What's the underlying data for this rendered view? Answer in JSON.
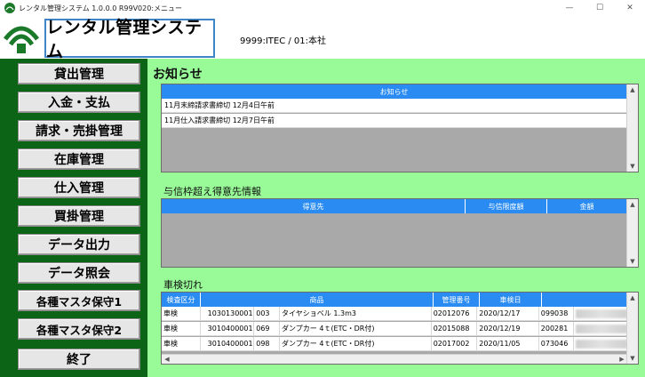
{
  "window": {
    "title": "レンタル管理システム 1.0.0.0 R99V020:メニュー",
    "minimize": "—",
    "maximize": "☐",
    "close": "✕"
  },
  "header": {
    "app_title": "レンタル管理システム",
    "company": "9999:ITEC / 01:本社"
  },
  "sidebar": {
    "items": [
      {
        "label": "貸出管理"
      },
      {
        "label": "入金・支払"
      },
      {
        "label": "請求・売掛管理"
      },
      {
        "label": "在庫管理"
      },
      {
        "label": "仕入管理"
      },
      {
        "label": "買掛管理"
      },
      {
        "label": "データ出力"
      },
      {
        "label": "データ照会"
      },
      {
        "label": "各種マスタ保守1"
      },
      {
        "label": "各種マスタ保守2"
      },
      {
        "label": "終了"
      }
    ]
  },
  "notices": {
    "title": "お知らせ",
    "column": "お知らせ",
    "rows": [
      "11月末締請求書締切  12月4日午前",
      "11月仕入請求書締切  12月7日午前"
    ]
  },
  "credit": {
    "title": "与信枠超え得意先情報",
    "columns": [
      "得意先",
      "与信限度額",
      "金額"
    ]
  },
  "inspection": {
    "title": "車検切れ",
    "columns": [
      "検査区分",
      "商品",
      "管理番号",
      "車検日"
    ],
    "rows": [
      {
        "kubun": "車検",
        "code": "1030130001",
        "sub": "003",
        "name": "タイヤショベル 1.3m3",
        "kanri": "02012076",
        "date": "2020/12/17",
        "no": "099038"
      },
      {
        "kubun": "車検",
        "code": "3010400001",
        "sub": "069",
        "name": "ダンプカー 4ｔ(ETC・DR付)",
        "kanri": "02015088",
        "date": "2020/12/19",
        "no": "200281"
      },
      {
        "kubun": "車検",
        "code": "3010400001",
        "sub": "098",
        "name": "ダンプカー 4ｔ(ETC・DR付)",
        "kanri": "02017002",
        "date": "2020/11/05",
        "no": "073046"
      }
    ]
  },
  "icons": {
    "scroll_up": "▲",
    "scroll_down": "▼",
    "scroll_left": "◀",
    "scroll_right": "▶"
  },
  "colors": {
    "sidebar_bg": "#0c6417",
    "main_bg": "#98fb98",
    "grid_header": "#2a8cf2",
    "title_border": "#3f86c9"
  }
}
